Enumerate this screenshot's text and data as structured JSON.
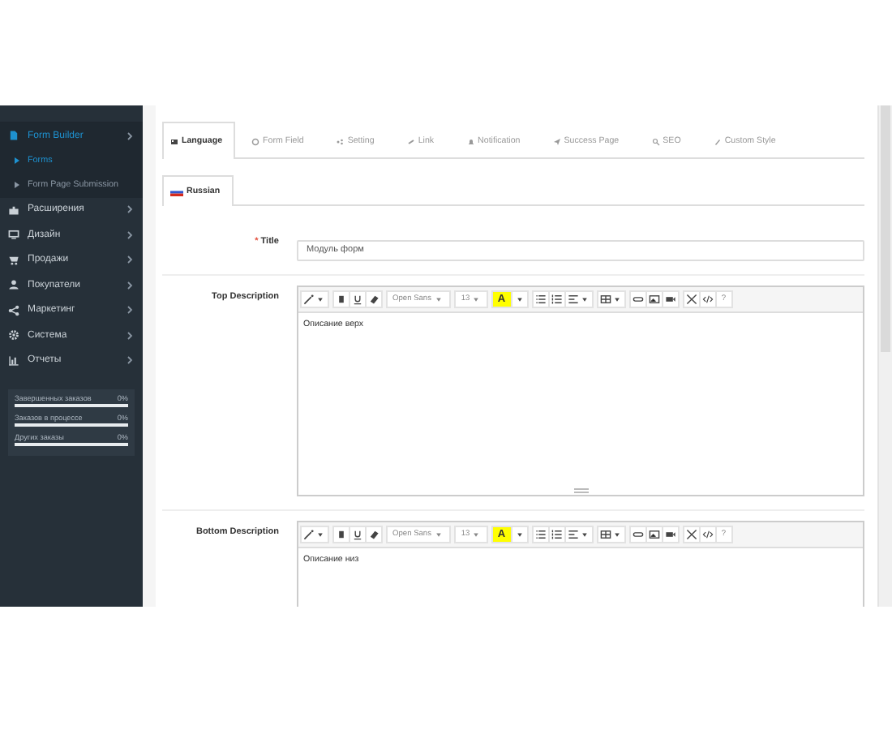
{
  "sidebar": {
    "items": [
      {
        "label": "Form Builder",
        "selected": true,
        "expanded": true,
        "children": [
          {
            "label": "Forms",
            "selected": true
          },
          {
            "label": "Form Page Submission",
            "selected": false
          }
        ]
      },
      {
        "label": "Расширения",
        "selected": false
      },
      {
        "label": "Дизайн",
        "selected": false
      },
      {
        "label": "Продажи",
        "selected": false
      },
      {
        "label": "Покупатели",
        "selected": false
      },
      {
        "label": "Маркетинг",
        "selected": false
      },
      {
        "label": "Система",
        "selected": false
      },
      {
        "label": "Отчеты",
        "selected": false
      }
    ],
    "stats": [
      {
        "label": "Завершенных заказов",
        "value": "0%",
        "level": 0
      },
      {
        "label": "Заказов в процессе",
        "value": "0%",
        "level": 0
      },
      {
        "label": "Других заказы",
        "value": "0%",
        "level": 0
      }
    ]
  },
  "tabs": [
    {
      "label": "Language",
      "selected": true
    },
    {
      "label": "Form Field",
      "selected": false
    },
    {
      "label": "Setting",
      "selected": false
    },
    {
      "label": "Link",
      "selected": false
    },
    {
      "label": "Notification",
      "selected": false
    },
    {
      "label": "Success Page",
      "selected": false
    },
    {
      "label": "SEO",
      "selected": false
    },
    {
      "label": "Custom Style",
      "selected": false
    }
  ],
  "language_tabs": [
    {
      "label": "Russian",
      "selected": true
    }
  ],
  "fields": [
    {
      "kind": "input",
      "label": "Title",
      "required_mark": "*",
      "value": "Модуль форм"
    },
    {
      "kind": "editor",
      "label": "Top Description",
      "value": "Описание верх",
      "font": "Open Sans",
      "size": "13",
      "color_label": "A",
      "help": "?"
    },
    {
      "kind": "editor",
      "label": "Bottom Description",
      "value": "Описание низ",
      "font": "Open Sans",
      "size": "13",
      "color_label": "A",
      "help": "?"
    }
  ]
}
